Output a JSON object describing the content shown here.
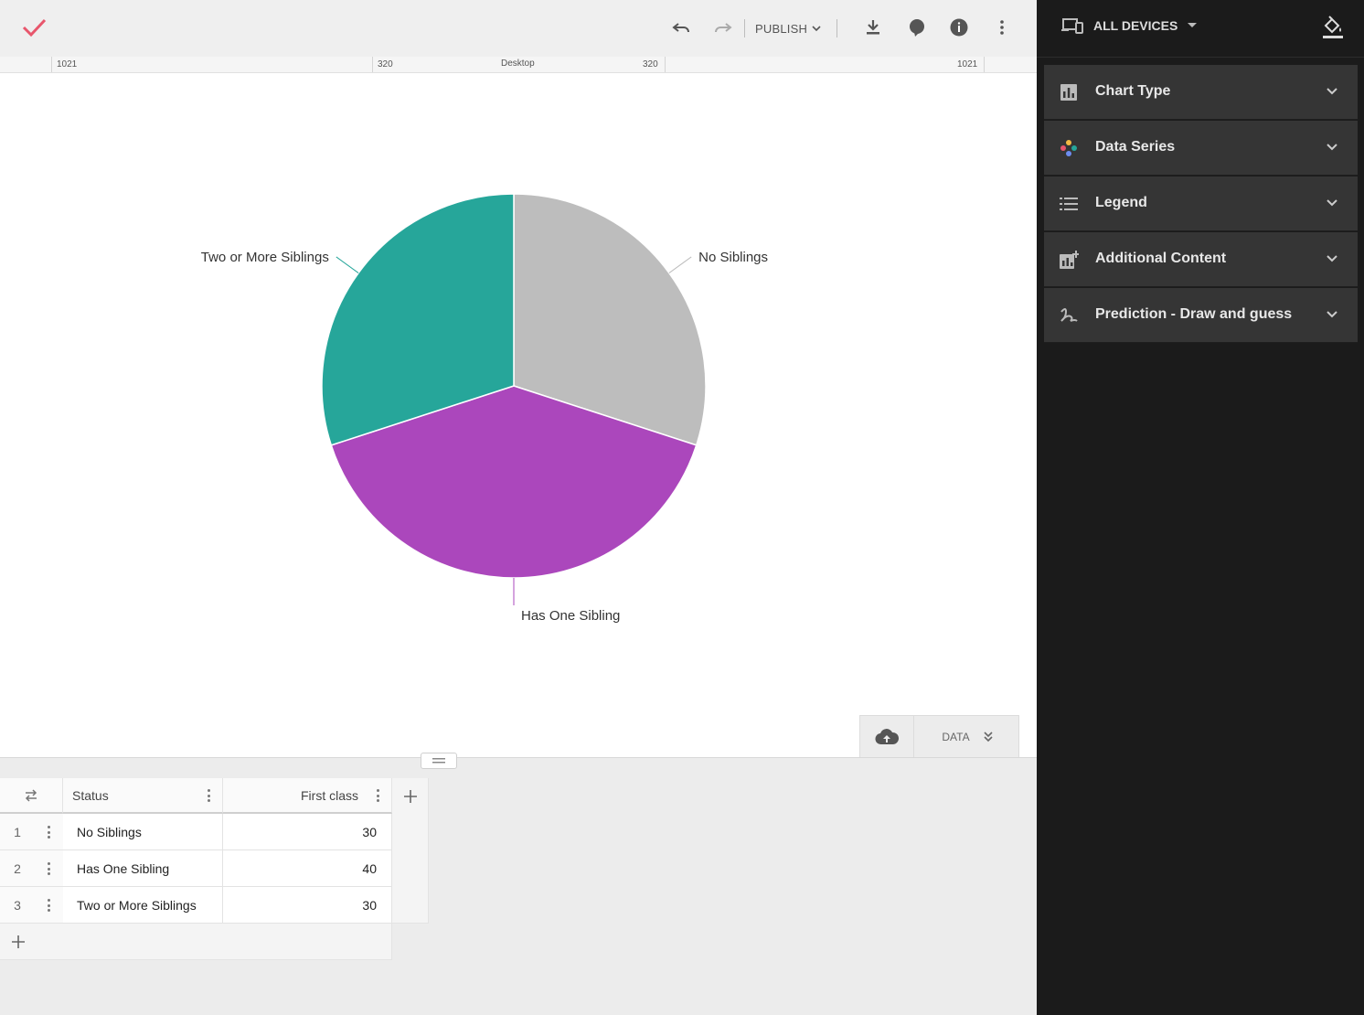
{
  "toolbar": {
    "publish_label": "PUBLISH"
  },
  "ruler": {
    "left_outer": "1021",
    "left_inner": "320",
    "center": "Desktop",
    "right_inner": "320",
    "right_outer": "1021"
  },
  "chart_data": {
    "type": "pie",
    "categories": [
      "No Siblings",
      "Has One Sibling",
      "Two or More Siblings"
    ],
    "values": [
      30,
      40,
      30
    ],
    "colors": [
      "#bdbdbd",
      "#ab47bc",
      "#26a69a"
    ]
  },
  "data_tabs": {
    "data_label": "DATA"
  },
  "table": {
    "columns": [
      "Status",
      "First class"
    ],
    "rows": [
      {
        "num": "1",
        "status": "No Siblings",
        "value": "30"
      },
      {
        "num": "2",
        "status": "Has One Sibling",
        "value": "40"
      },
      {
        "num": "3",
        "status": "Two or More Siblings",
        "value": "30"
      }
    ]
  },
  "right_panel": {
    "device_label": "ALL DEVICES",
    "sections": [
      {
        "label": "Chart Type",
        "icon": "bar-chart-icon"
      },
      {
        "label": "Data Series",
        "icon": "palette-dots-icon"
      },
      {
        "label": "Legend",
        "icon": "list-icon"
      },
      {
        "label": "Additional Content",
        "icon": "add-chart-icon"
      },
      {
        "label": "Prediction - Draw and guess",
        "icon": "scribble-icon"
      }
    ]
  },
  "colors": {
    "accent_check": "#e8566c",
    "panel_bg": "#1b1b1b",
    "section_bg": "#353535"
  }
}
